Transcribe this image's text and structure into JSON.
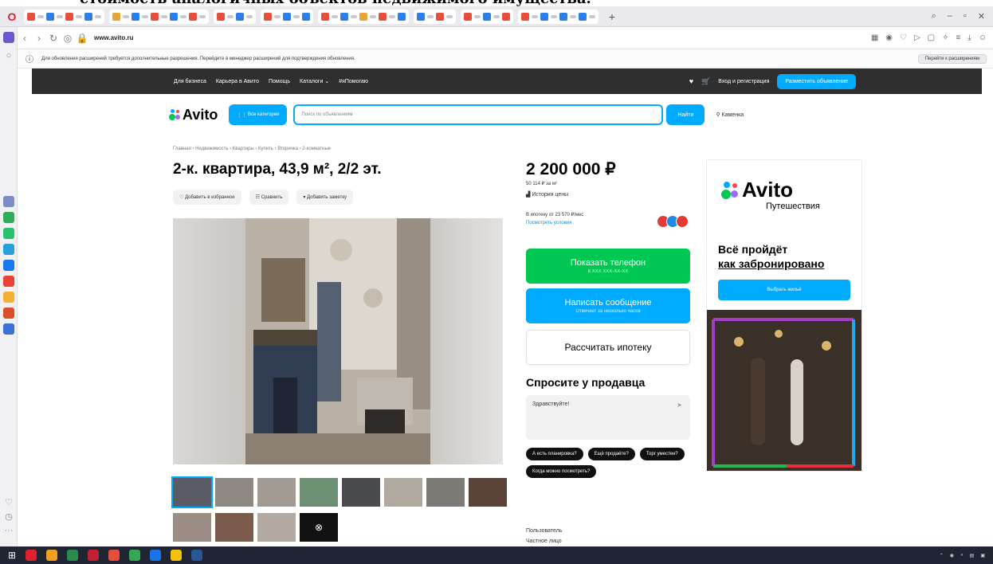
{
  "caption": "стоимость аналогичных объектов недвижимого имущества.",
  "browser": {
    "url_host": "www.avito.ru",
    "notification": "Для обновления расширений требуется дополнительные разрешения. Перейдите в менеджер расширений для подтверждения обновления.",
    "notification_button": "Перейти к расширениям"
  },
  "site": {
    "top_nav": [
      "Для бизнеса",
      "Карьера в Авито",
      "Помощь",
      "Каталоги",
      "#яПомогаю"
    ],
    "login": "Вход и регистрация",
    "post_ad": "Разместить объявление",
    "logo": "Avito",
    "all_categories": "Все категории",
    "search_placeholder": "Поиск по объявлениям",
    "search_button": "Найти",
    "location": "Каменка"
  },
  "listing": {
    "breadcrumbs": "Главная › Недвижимость › Квартиры › Купить › Вторичка › 2-комнатные",
    "title": "2-к. квартира, 43,9 м², 2/2 эт.",
    "add_favorite": "Добавить в избранное",
    "compare": "Сравнить",
    "add_note": "Добавить заметку",
    "price": "2 200 000 ₽",
    "price_per_m2": "50 114 ₽ за м²",
    "price_history": "История цены",
    "mortgage_text": "В ипотеку от 23 570 ₽/мес",
    "mortgage_link": "Посмотреть условия",
    "show_phone": "Показать телефон",
    "phone_mask": "8 XXX XXX-XX-XX",
    "write_message": "Написать сообщение",
    "reply_time": "Отвечает за несколько часов",
    "calc_mortgage": "Рассчитать ипотеку",
    "ask_seller": "Спросите у продавца",
    "message_draft": "Здравствуйте!",
    "quick_questions": [
      "А есть планировка?",
      "Ещё продаёте?",
      "Торг уместен?",
      "Когда можно посмотреть?"
    ],
    "seller_label": "Пользователь",
    "seller_type": "Частное лицо"
  },
  "ad": {
    "logo": "Avito",
    "subtitle": "Путешествия",
    "headline1": "Всё пройдёт",
    "headline2": "как забронировано",
    "button": "Выбрать жильё"
  },
  "colors": {
    "accent": "#00aaff",
    "phone_green": "#00c853",
    "dark": "#2f2f2f"
  }
}
